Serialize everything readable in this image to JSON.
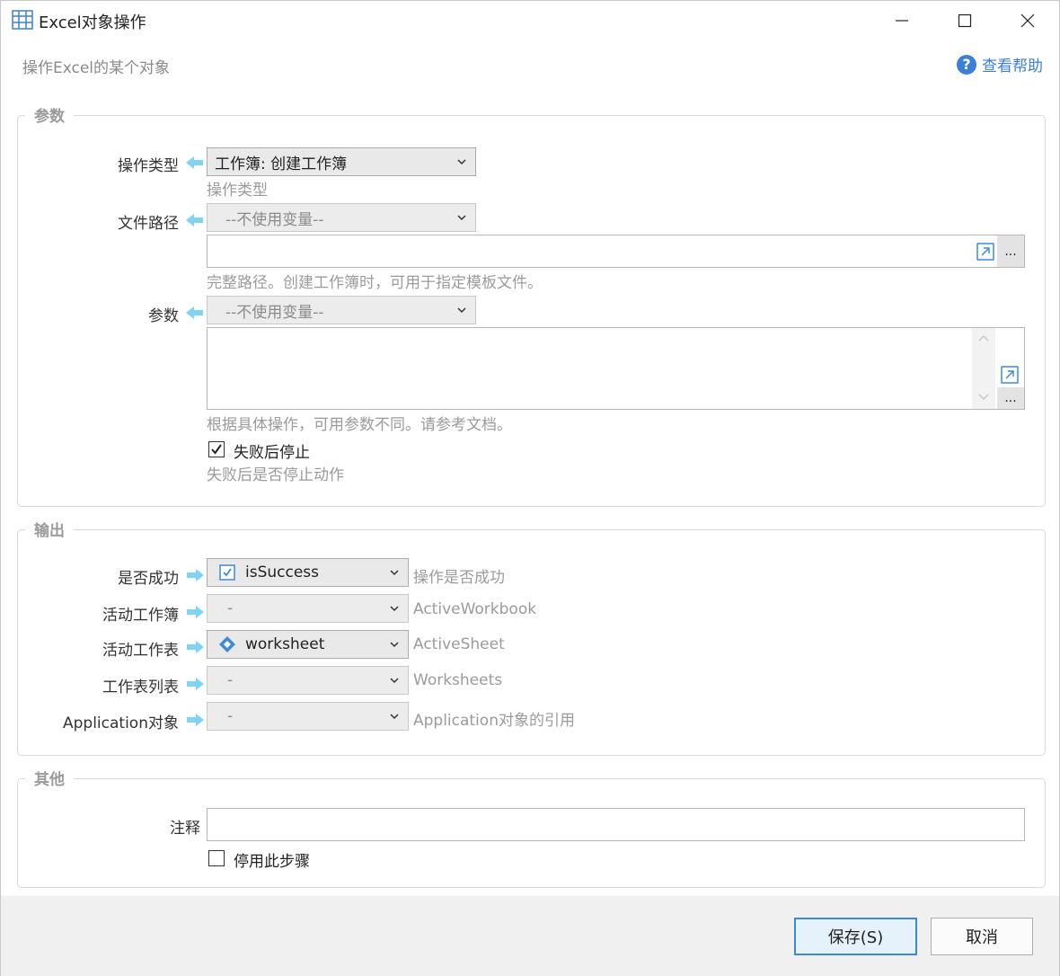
{
  "window": {
    "title": "Excel对象操作",
    "subtitle": "操作Excel的某个对象",
    "help_label": "查看帮助"
  },
  "params_group": {
    "title": "参数",
    "op_type": {
      "label": "操作类型",
      "value": "工作簿: 创建工作簿",
      "hint": "操作类型"
    },
    "file_path": {
      "label": "文件路径",
      "variable_select": "--不使用变量--",
      "value": "",
      "hint": "完整路径。创建工作簿时，可用于指定模板文件。"
    },
    "params": {
      "label": "参数",
      "variable_select": "--不使用变量--",
      "value": "",
      "hint": "根据具体操作，可用参数不同。请参考文档。"
    },
    "stop_on_fail": {
      "label": "失败后停止",
      "checked": true,
      "hint": "失败后是否停止动作"
    },
    "dots_label": "..."
  },
  "output_group": {
    "title": "输出",
    "rows": [
      {
        "label": "是否成功",
        "value": "isSuccess",
        "icon": "checkbox-variable-icon",
        "hint": "操作是否成功"
      },
      {
        "label": "活动工作簿",
        "value": "-",
        "icon": "",
        "hint": "ActiveWorkbook"
      },
      {
        "label": "活动工作表",
        "value": "worksheet",
        "icon": "diamond-variable-icon",
        "hint": "ActiveSheet"
      },
      {
        "label": "工作表列表",
        "value": "-",
        "icon": "",
        "hint": "Worksheets"
      },
      {
        "label": "Application对象",
        "value": "-",
        "icon": "",
        "hint": "Application对象的引用"
      }
    ]
  },
  "other_group": {
    "title": "其他",
    "comment_label": "注释",
    "comment_value": "",
    "disable_step_label": "停用此步骤",
    "disable_step_checked": false
  },
  "footer": {
    "save_label": "保存(S)",
    "cancel_label": "取消"
  },
  "colors": {
    "accent": "#3c8ad6",
    "arrow": "#7fd3f5",
    "hint": "#9b9b9b"
  }
}
